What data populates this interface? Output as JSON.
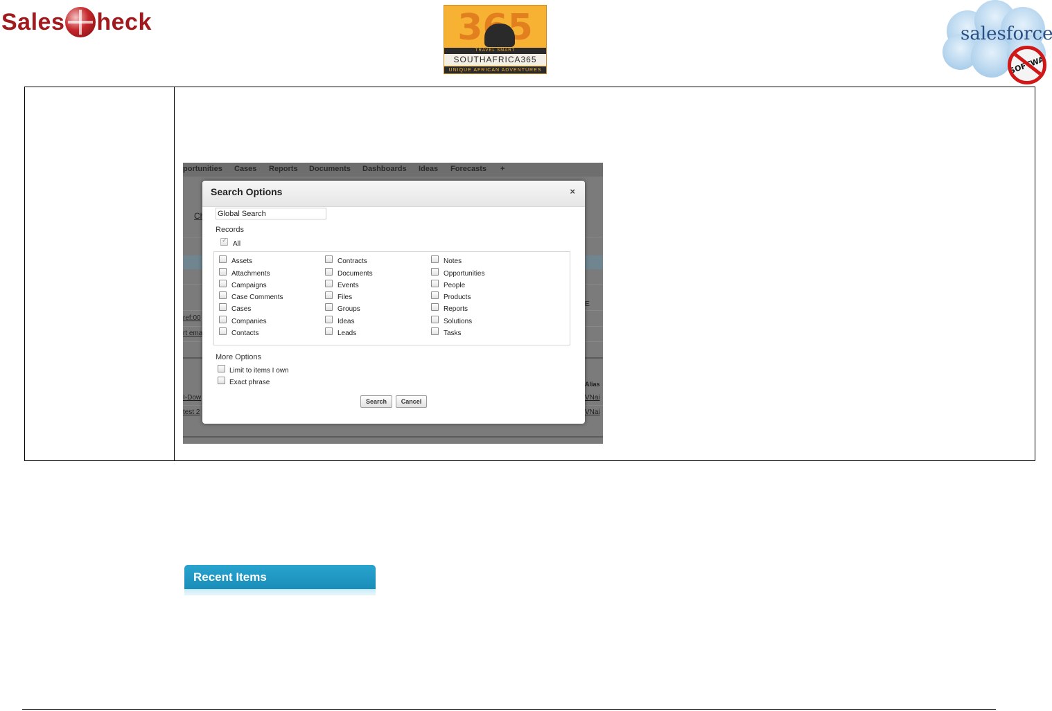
{
  "header": {
    "salescheck_logo": {
      "left": "Sales",
      "right": "heck"
    },
    "sa365_logo": {
      "number": "365",
      "tagline_top": "TRAVEL SMART",
      "name": "SOUTHAFRICA365",
      "tagline_bottom": "UNIQUE AFRICAN ADVENTURES"
    },
    "salesforce_logo": {
      "word": "salesforce",
      "stamp": "SOFTWARE"
    }
  },
  "screenshot": {
    "nav_tabs": [
      "portunities",
      "Cases",
      "Reports",
      "Documents",
      "Dashboards",
      "Ideas",
      "Forecasts",
      "+"
    ],
    "background_fragments": [
      "Ch",
      "ref:00",
      "rt ema",
      "I-Dow",
      "test 2",
      "Alias",
      "VNai",
      "VNai",
      "E"
    ],
    "dialog": {
      "title": "Search Options",
      "close": "×",
      "search_value": "Global Search",
      "records_label": "Records",
      "all_label": "All",
      "all_checked": true,
      "columns": [
        [
          "Assets",
          "Attachments",
          "Campaigns",
          "Case Comments",
          "Cases",
          "Companies",
          "Contacts"
        ],
        [
          "Contracts",
          "Documents",
          "Events",
          "Files",
          "Groups",
          "Ideas",
          "Leads"
        ],
        [
          "Notes",
          "Opportunities",
          "People",
          "Products",
          "Reports",
          "Solutions",
          "Tasks"
        ]
      ],
      "more_options_label": "More Options",
      "more_options": [
        "Limit to items I own",
        "Exact phrase"
      ],
      "search_button": "Search",
      "cancel_button": "Cancel"
    }
  },
  "recent_items": {
    "title": "Recent Items"
  },
  "colors": {
    "brand_red": "#a11a1e",
    "recent_blue": "#1a8db8",
    "dialog_bg": "#ffffff",
    "overlay": "#7b7b7b"
  }
}
